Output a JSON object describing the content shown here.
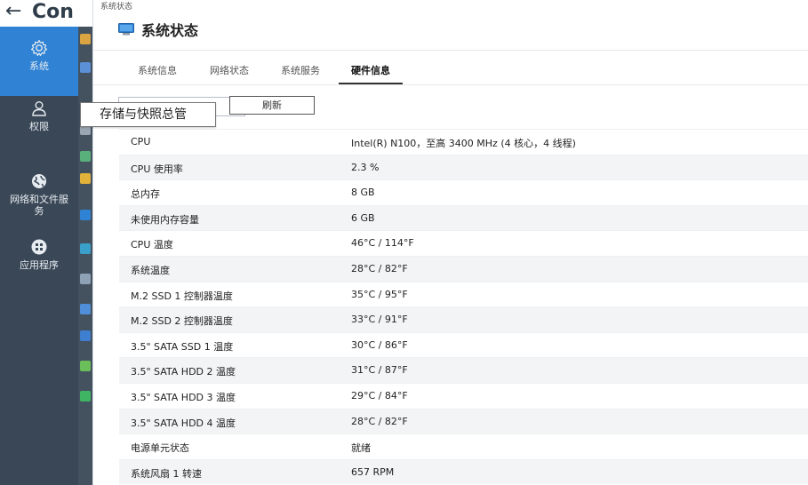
{
  "control_panel": {
    "back_glyph": "←",
    "title": "Con"
  },
  "sidebar": {
    "items": [
      {
        "label": "系统",
        "icon": "gear-icon"
      },
      {
        "label": "权限",
        "icon": "user-icon"
      },
      {
        "label": "网络和文件服务",
        "icon": "globe-icon"
      },
      {
        "label": "应用程序",
        "icon": "apps-grid-icon"
      }
    ]
  },
  "modal": {
    "titlebar": "系统状态",
    "heading": "系统状态",
    "tabs": [
      {
        "label": "系统信息"
      },
      {
        "label": "网络状态"
      },
      {
        "label": "系统服务"
      },
      {
        "label": "硬件信息"
      }
    ],
    "refresh_label": "刷新",
    "rows": [
      {
        "key": "CPU",
        "value": "Intel(R) N100，至高 3400 MHz (4 核心，4 线程)"
      },
      {
        "key": "CPU 使用率",
        "value": "2.3 %"
      },
      {
        "key": "总内存",
        "value": "8 GB"
      },
      {
        "key": "未使用内存容量",
        "value": "6 GB"
      },
      {
        "key": "CPU 温度",
        "value": "46°C / 114°F"
      },
      {
        "key": "系统温度",
        "value": "28°C / 82°F"
      },
      {
        "key": "M.2 SSD 1 控制器温度",
        "value": "35°C / 95°F"
      },
      {
        "key": "M.2 SSD 2 控制器温度",
        "value": "33°C / 91°F"
      },
      {
        "key": "3.5\" SATA SSD 1 温度",
        "value": "30°C / 86°F"
      },
      {
        "key": "3.5\" SATA HDD 2 温度",
        "value": "31°C / 87°F"
      },
      {
        "key": "3.5\" SATA HDD 3 温度",
        "value": "29°C / 84°F"
      },
      {
        "key": "3.5\" SATA HDD 4 温度",
        "value": "28°C / 82°F"
      },
      {
        "key": "电源单元状态",
        "value": "就绪"
      },
      {
        "key": "系统风扇 1 转速",
        "value": "657 RPM"
      }
    ]
  },
  "tooltip": {
    "text": "存储与快照总管"
  },
  "colors": {
    "sidebar_bg": "#3a4756",
    "sidebar_active": "#2f82d4",
    "monitor_icon": "#2f82d4"
  }
}
